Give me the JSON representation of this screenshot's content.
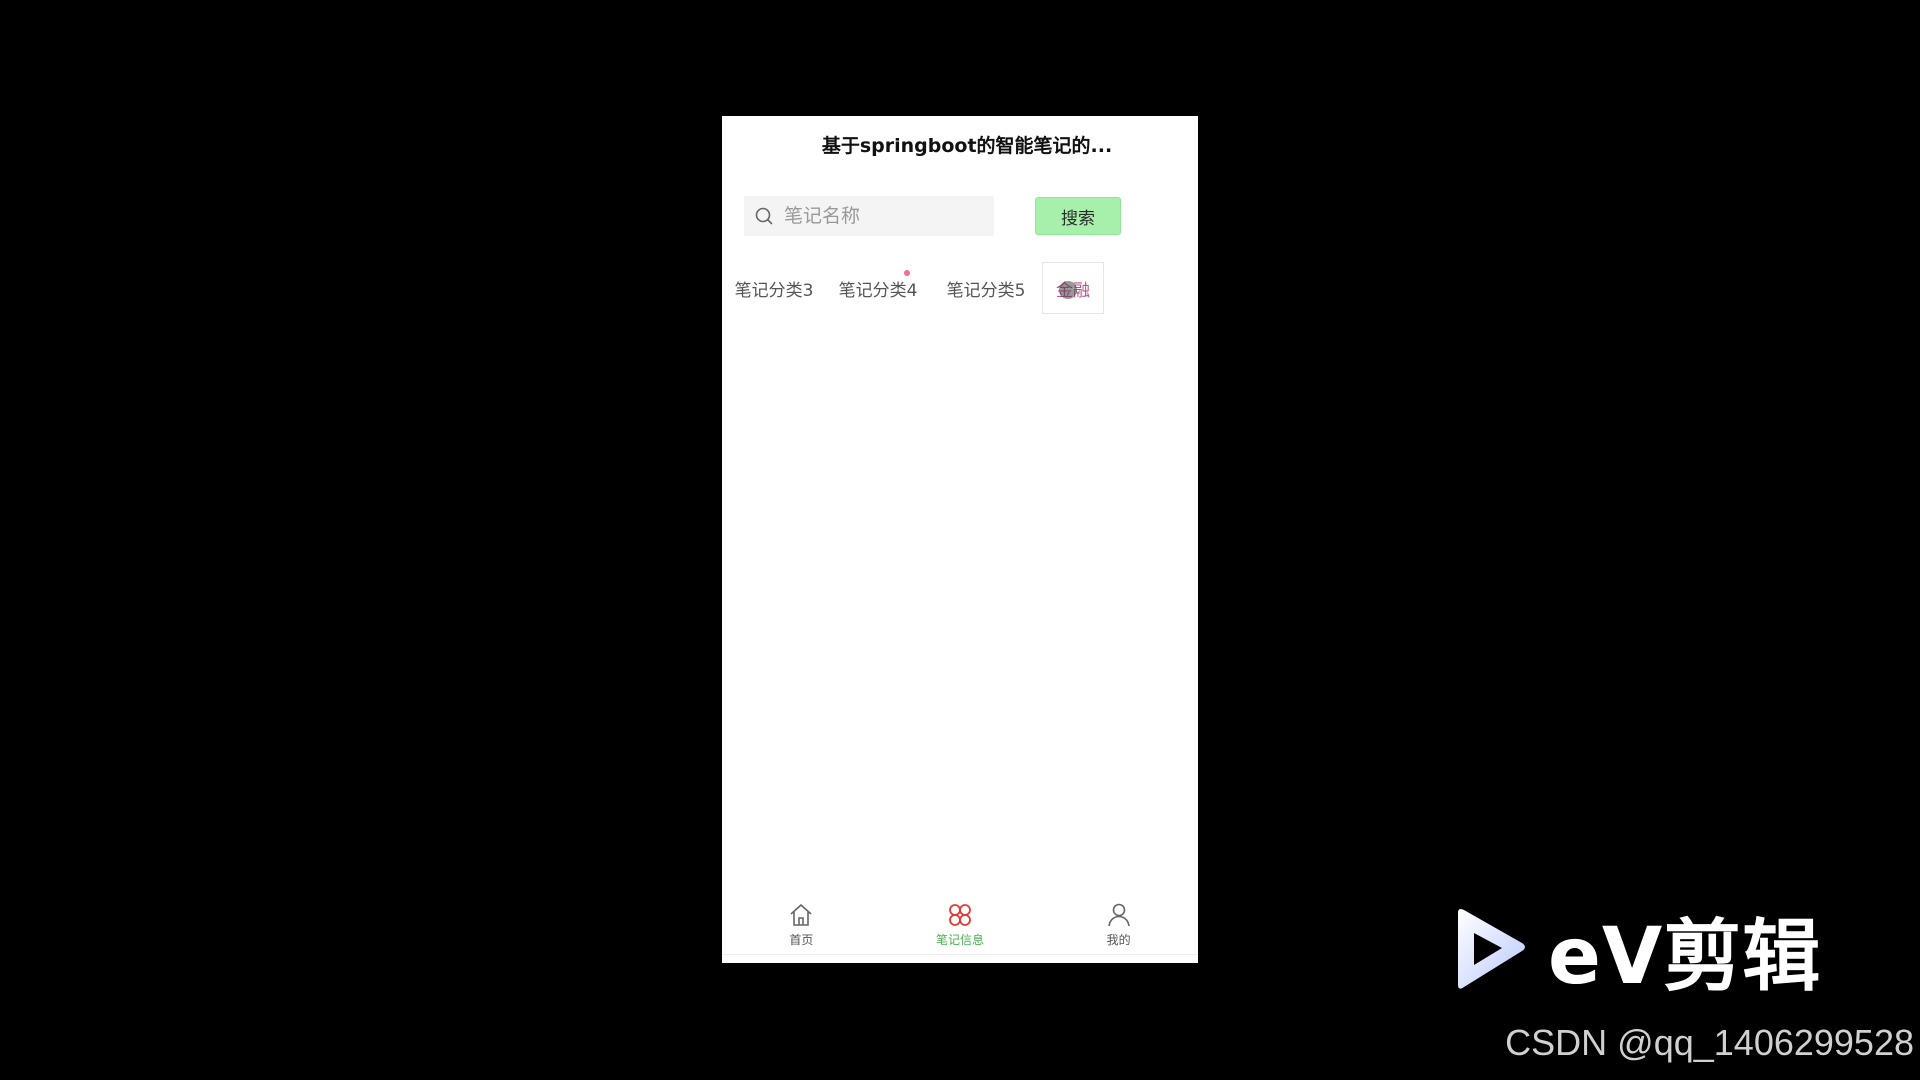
{
  "header": {
    "title": "基于springboot的智能笔记的..."
  },
  "search": {
    "placeholder": "笔记名称",
    "button_label": "搜索"
  },
  "categories": [
    {
      "label": "笔记分类3"
    },
    {
      "label": "笔记分类4"
    },
    {
      "label": "笔记分类5"
    },
    {
      "label": "金融"
    }
  ],
  "tabbar": {
    "items": [
      {
        "label": "首页",
        "icon": "home-icon"
      },
      {
        "label": "笔记信息",
        "icon": "grid-icon"
      },
      {
        "label": "我的",
        "icon": "user-icon"
      }
    ]
  },
  "overlay": {
    "brand": "eV剪辑",
    "watermark": "CSDN @qq_1406299528"
  },
  "colors": {
    "search_button": "#a6f0ab",
    "active_tab": "#4caf50",
    "active_category": "#c0508f"
  }
}
